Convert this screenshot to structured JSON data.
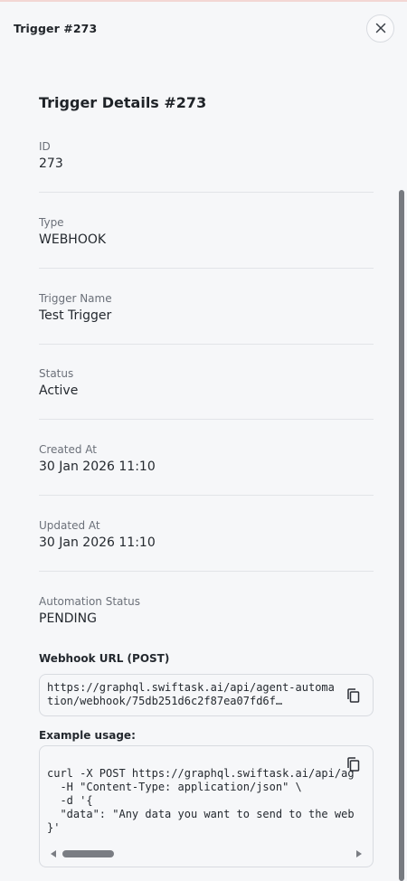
{
  "panel": {
    "title": "Trigger #273"
  },
  "details": {
    "heading": "Trigger Details #273",
    "fields": [
      {
        "label": "ID",
        "value": "273"
      },
      {
        "label": "Type",
        "value": "WEBHOOK"
      },
      {
        "label": "Trigger Name",
        "value": "Test Trigger"
      },
      {
        "label": "Status",
        "value": "Active"
      },
      {
        "label": "Created At",
        "value": "30 Jan 2026 11:10"
      },
      {
        "label": "Updated At",
        "value": "30 Jan 2026 11:10"
      },
      {
        "label": "Automation Status",
        "value": "PENDING"
      }
    ]
  },
  "webhook": {
    "label": "Webhook URL (POST)",
    "url": "https://graphql.swiftask.ai/api/agent-automation/webhook/75db251d6c2f87ea07fd6f…"
  },
  "example": {
    "label": "Example usage:",
    "code": "curl -X POST https://graphql.swiftask.ai/api/ag\n  -H \"Content-Type: application/json\" \\\n  -d '{\n  \"data\": \"Any data you want to send to the web\n}'"
  },
  "icons": {
    "close": "close-icon",
    "copy": "copy-icon"
  }
}
